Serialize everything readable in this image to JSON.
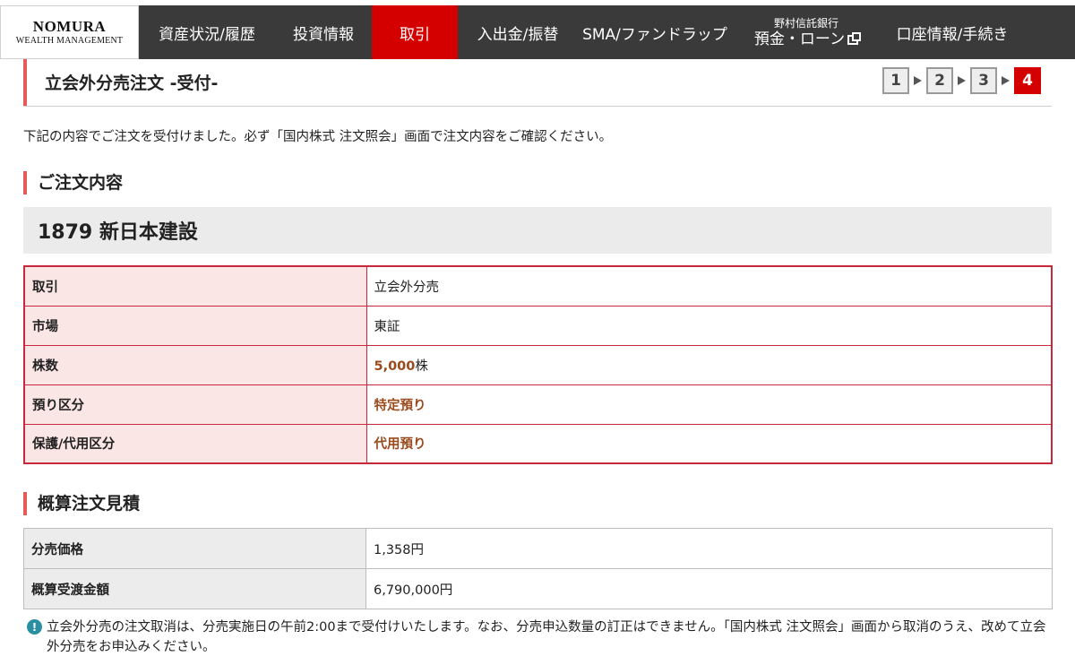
{
  "logo": {
    "line1": "NOMURA",
    "line2": "WEALTH MANAGEMENT"
  },
  "nav": {
    "items": [
      {
        "label": "資産状況/履歴"
      },
      {
        "label": "投資情報"
      },
      {
        "label": "取引"
      },
      {
        "label": "入出金/振替"
      },
      {
        "label": "SMA/ファンドラップ"
      },
      {
        "small": "野村信託銀行",
        "label": "預金・ローン"
      },
      {
        "label": "口座情報/手続き"
      }
    ]
  },
  "page": {
    "title": "立会外分売注文 -受付-",
    "steps": [
      "1",
      "2",
      "3",
      "4"
    ],
    "intro": "下記の内容でご注文を受付けました。必ず「国内株式 注文照会」画面で注文内容をご確認ください。"
  },
  "order": {
    "heading": "ご注文内容",
    "stock": "1879 新日本建設",
    "rows": [
      {
        "label": "取引",
        "value": "立会外分売"
      },
      {
        "label": "市場",
        "value": "東証"
      },
      {
        "label": "株数",
        "value_num": "5,000",
        "value_unit": "株"
      },
      {
        "label": "預り区分",
        "value": "特定預り"
      },
      {
        "label": "保護/代用区分",
        "value": "代用預り"
      }
    ]
  },
  "estimate": {
    "heading": "概算注文見積",
    "rows": [
      {
        "label": "分売価格",
        "value": "1,358円"
      },
      {
        "label": "概算受渡金額",
        "value": "6,790,000円"
      }
    ]
  },
  "note": {
    "icon": "!",
    "text": "立会外分売の注文取消は、分売実施日の午前2:00まで受付けいたします。なお、分売申込数量の訂正はできません。「国内株式 注文照会」画面から取消のうえ、改めて立会外分売をお申込みください。"
  },
  "colors": {
    "accent": "#d40000",
    "nav_bg": "#3a3a3a",
    "highlight": "#9b4a1c"
  }
}
